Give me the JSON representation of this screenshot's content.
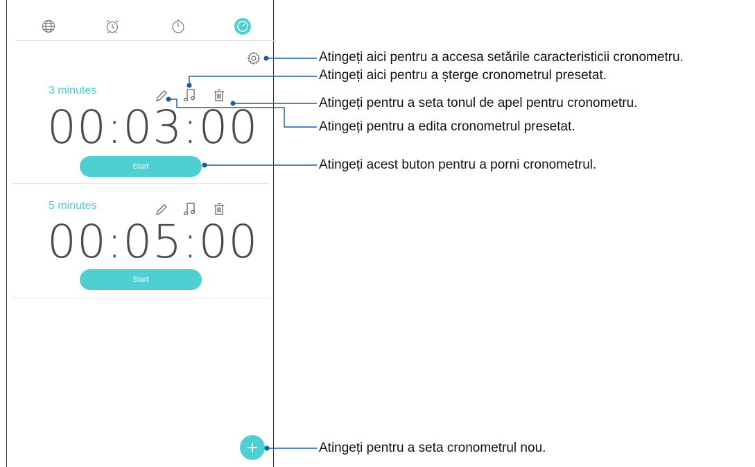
{
  "tabs": [
    {
      "icon": "globe-icon"
    },
    {
      "icon": "alarm-icon"
    },
    {
      "icon": "stopwatch-icon"
    },
    {
      "icon": "timer-icon",
      "active": true
    }
  ],
  "settings_icon": "gear-icon",
  "timers": [
    {
      "label": "3 minutes",
      "time": "00:03:00",
      "start_label": "Start"
    },
    {
      "label": "5 minutes",
      "time": "00:05:00",
      "start_label": "Start"
    }
  ],
  "fab_icon": "plus-icon",
  "callouts": {
    "settings": "Atingeți aici pentru a accesa setările caracteristicii cronometru.",
    "delete": "Atingeți aici pentru a șterge cronometrul presetat.",
    "ringtone": "Atingeți pentru a seta tonul de apel pentru cronometru.",
    "edit": "Atingeți pentru a edita cronometrul presetat.",
    "start": "Atingeți acest buton pentru a porni cronometrul.",
    "new": "Atingeți pentru a seta cronometrul nou."
  },
  "colors": {
    "accent": "#4ed0d3",
    "label": "#4ecbd1",
    "callout_line": "#1a5aa0"
  }
}
